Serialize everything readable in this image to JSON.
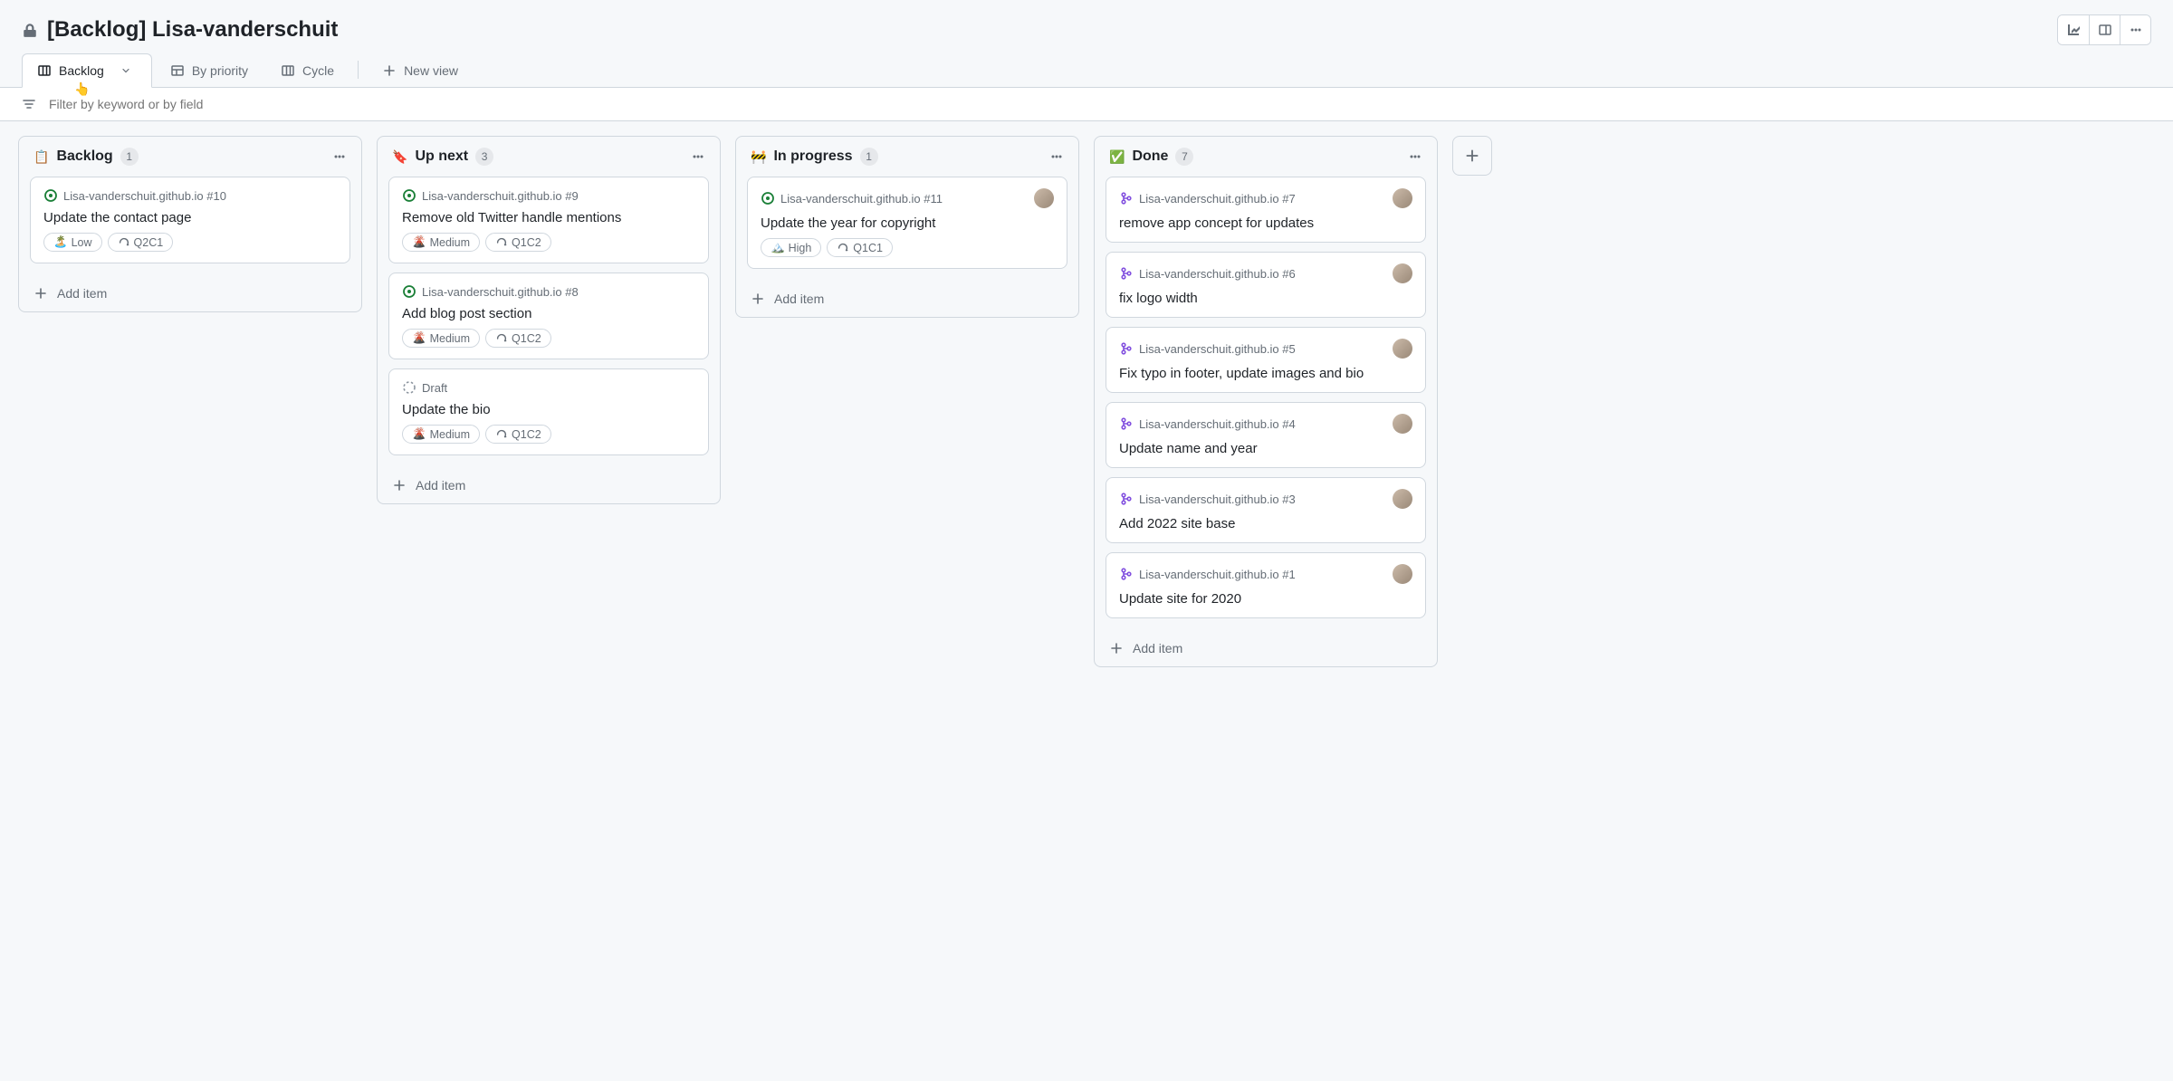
{
  "header": {
    "title": "[Backlog] Lisa-vanderschuit"
  },
  "tabs": [
    {
      "label": "Backlog",
      "icon": "board",
      "active": true,
      "hasMenu": true
    },
    {
      "label": "By priority",
      "icon": "table",
      "active": false,
      "hasMenu": false
    },
    {
      "label": "Cycle",
      "icon": "board",
      "active": false,
      "hasMenu": false
    }
  ],
  "newViewLabel": "New view",
  "filterPlaceholder": "Filter by keyword or by field",
  "addItemLabel": "Add item",
  "columns": [
    {
      "id": "backlog",
      "emoji": "📋",
      "title": "Backlog",
      "count": "1",
      "cards": [
        {
          "status": "open",
          "repo": "Lisa-vanderschuit.github.io #10",
          "title": "Update the contact page",
          "labels": [
            {
              "emoji": "🏝️",
              "text": "Low"
            },
            {
              "icon": "iteration",
              "text": "Q2C1"
            }
          ],
          "avatar": false
        }
      ]
    },
    {
      "id": "upnext",
      "emoji": "🔖",
      "title": "Up next",
      "count": "3",
      "cards": [
        {
          "status": "open",
          "repo": "Lisa-vanderschuit.github.io #9",
          "title": "Remove old Twitter handle mentions",
          "labels": [
            {
              "emoji": "🌋",
              "text": "Medium"
            },
            {
              "icon": "iteration",
              "text": "Q1C2"
            }
          ],
          "avatar": false
        },
        {
          "status": "open",
          "repo": "Lisa-vanderschuit.github.io #8",
          "title": "Add blog post section",
          "labels": [
            {
              "emoji": "🌋",
              "text": "Medium"
            },
            {
              "icon": "iteration",
              "text": "Q1C2"
            }
          ],
          "avatar": false
        },
        {
          "status": "draft",
          "repo": "Draft",
          "title": "Update the bio",
          "labels": [
            {
              "emoji": "🌋",
              "text": "Medium"
            },
            {
              "icon": "iteration",
              "text": "Q1C2"
            }
          ],
          "avatar": false
        }
      ]
    },
    {
      "id": "inprogress",
      "emoji": "🚧",
      "title": "In progress",
      "count": "1",
      "cards": [
        {
          "status": "open",
          "repo": "Lisa-vanderschuit.github.io #11",
          "title": "Update the year for copyright",
          "labels": [
            {
              "emoji": "🏔️",
              "text": "High"
            },
            {
              "icon": "iteration",
              "text": "Q1C1"
            }
          ],
          "avatar": true
        }
      ]
    },
    {
      "id": "done",
      "emoji": "✅",
      "title": "Done",
      "count": "7",
      "cards": [
        {
          "status": "merged",
          "repo": "Lisa-vanderschuit.github.io #7",
          "title": "remove app concept for updates",
          "labels": [],
          "avatar": true
        },
        {
          "status": "merged",
          "repo": "Lisa-vanderschuit.github.io #6",
          "title": "fix logo width",
          "labels": [],
          "avatar": true
        },
        {
          "status": "merged",
          "repo": "Lisa-vanderschuit.github.io #5",
          "title": "Fix typo in footer, update images and bio",
          "labels": [],
          "avatar": true
        },
        {
          "status": "merged",
          "repo": "Lisa-vanderschuit.github.io #4",
          "title": "Update name and year",
          "labels": [],
          "avatar": true
        },
        {
          "status": "merged",
          "repo": "Lisa-vanderschuit.github.io #3",
          "title": "Add 2022 site base",
          "labels": [],
          "avatar": true
        },
        {
          "status": "merged",
          "repo": "Lisa-vanderschuit.github.io #1",
          "title": "Update site for 2020",
          "labels": [],
          "avatar": true
        }
      ]
    }
  ]
}
